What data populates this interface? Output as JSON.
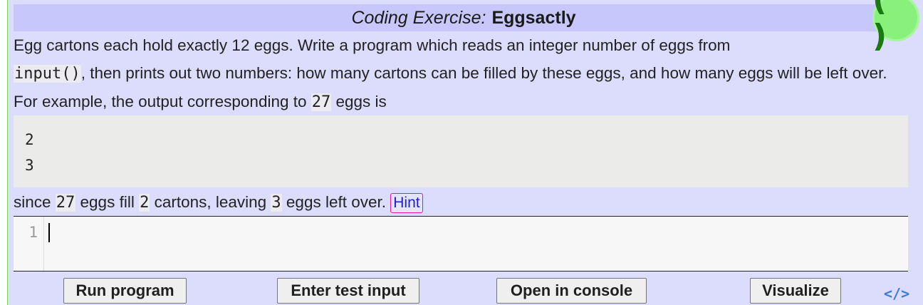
{
  "header": {
    "prefix": "Coding Exercise:",
    "title": "Eggsactly",
    "logo_text": "( )"
  },
  "description": {
    "part1": "Egg cartons each hold exactly 12 eggs. Write a program which reads an integer number of eggs from",
    "code1": "input()",
    "part2": ", then prints out two numbers: how many cartons can be filled by these eggs, and how many eggs will be left over. For example, the output corresponding to ",
    "code2": "27",
    "part3": " eggs is"
  },
  "example_output": [
    "2",
    "3"
  ],
  "explanation": {
    "part1": "since ",
    "code1": "27",
    "part2": " eggs fill ",
    "code2": "2",
    "part3": " cartons, leaving ",
    "code3": "3",
    "part4": " eggs left over. ",
    "hint_label": "Hint"
  },
  "editor": {
    "line_numbers": [
      "1"
    ],
    "content": ""
  },
  "buttons": {
    "run": "Run program",
    "test_input": "Enter test input",
    "console": "Open in console",
    "visualize": "Visualize"
  },
  "embed_label": "</>",
  "colors": {
    "panel_bg": "#dcdcfd",
    "title_bg": "#c7c7fb",
    "logo_green": "#88f07b",
    "hint_border": "#e0179e",
    "embed_blue": "#3a7ad8"
  }
}
